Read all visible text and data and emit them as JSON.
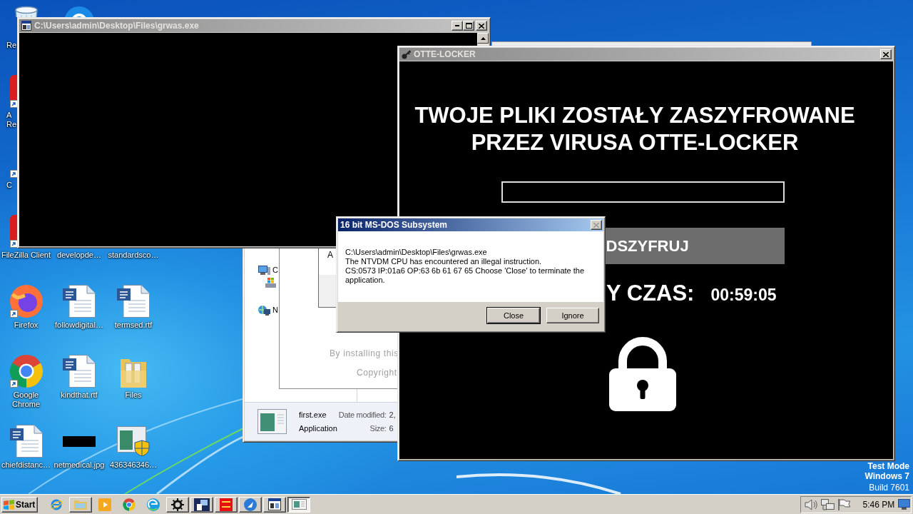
{
  "desktop": {
    "columns": [
      [
        {
          "kind": "recycle-bin",
          "label": "Re",
          "shortcut": false
        },
        {
          "kind": "red-app",
          "label": "A\nRe",
          "shortcut": true
        },
        {
          "label": "C",
          "shortcut": true
        },
        {
          "kind": "red-app",
          "label": "FileZilla Client",
          "shortcut": true
        },
        {
          "kind": "firefox",
          "label": "Firefox",
          "shortcut": true
        },
        {
          "kind": "chrome",
          "label": "Google Chrome",
          "shortcut": true
        },
        {
          "kind": "word",
          "label": "chiefdistanc…",
          "shortcut": false
        }
      ],
      [
        {
          "kind": "blue-app",
          "shortcut": false
        },
        null,
        null,
        {
          "label": "developde…"
        },
        {
          "kind": "word",
          "label": "followdigital…",
          "shortcut": false
        },
        {
          "kind": "word",
          "label": "kindthat.rtf",
          "shortcut": false
        },
        {
          "kind": "image",
          "label": "netmedical.jpg",
          "shortcut": false
        }
      ],
      [
        null,
        null,
        null,
        {
          "label": "standardsco…"
        },
        {
          "kind": "word",
          "label": "termsed.rtf",
          "shortcut": false
        },
        {
          "kind": "folder",
          "label": "Files",
          "shortcut": false
        },
        {
          "kind": "installer",
          "label": "436346346…",
          "shortcut": false
        }
      ]
    ]
  },
  "test_mode": [
    {
      "text": "Test Mode",
      "bold": true
    },
    {
      "text": "Windows 7",
      "bold": true
    },
    {
      "text": "Build 7601",
      "bold": false
    }
  ],
  "explorer": {
    "nav_items": [
      {
        "kind": "computer",
        "label": "C",
        "children": [
          {
            "kind": "drive"
          }
        ]
      },
      {
        "kind": "network",
        "label": "N"
      }
    ],
    "details": {
      "name": "first.exe",
      "type": "Application",
      "date_label": "Date modified:",
      "date_value": "2,",
      "size_label": "Size:",
      "size_value": "6"
    }
  },
  "installer": {
    "panel_text": "A",
    "footer_lines": [
      "By installing this",
      "Copyright"
    ]
  },
  "console": {
    "title": "C:\\Users\\admin\\Desktop\\Files\\grwas.exe",
    "active": false
  },
  "locker": {
    "title": "OTTE-LOCKER",
    "active": false,
    "heading": "TWOJE PLIKI ZOSTAŁY ZASZYFROWANE\nPRZEZ VIRUSA OTTE-LOCKER",
    "button_label": "DSZYFRUJ",
    "timer_label": "Y CZAS:",
    "timer": "00:59:05"
  },
  "dialog": {
    "title": "16 bit MS-DOS Subsystem",
    "active": true,
    "close_disabled": true,
    "message": [
      "C:\\Users\\admin\\Desktop\\Files\\grwas.exe",
      "The NTVDM CPU has encountered an illegal instruction.",
      "CS:0573 IP:01a6 OP:63 6b 61 67 65 Choose 'Close' to terminate the application."
    ],
    "buttons": [
      {
        "label": "Close",
        "default": true
      },
      {
        "label": "Ignore",
        "default": false
      }
    ]
  },
  "taskbar": {
    "start_label": "Start",
    "items": [
      {
        "kind": "ie",
        "running": false,
        "selected": false
      },
      {
        "kind": "folder",
        "running": true,
        "selected": false
      },
      {
        "kind": "media",
        "running": false,
        "selected": false
      },
      {
        "kind": "chrome",
        "running": false,
        "selected": false
      },
      {
        "kind": "edge",
        "running": false,
        "selected": false
      },
      {
        "kind": "gear",
        "running": true,
        "selected": false
      },
      {
        "kind": "navy-app",
        "running": true,
        "selected": false
      },
      {
        "kind": "red-app",
        "running": true,
        "selected": false
      },
      {
        "kind": "blue-app",
        "running": true,
        "selected": false
      },
      {
        "kind": "console",
        "running": true,
        "selected": false
      },
      {
        "kind": "window",
        "running": true,
        "selected": true
      }
    ],
    "clock": "5:46 PM"
  }
}
